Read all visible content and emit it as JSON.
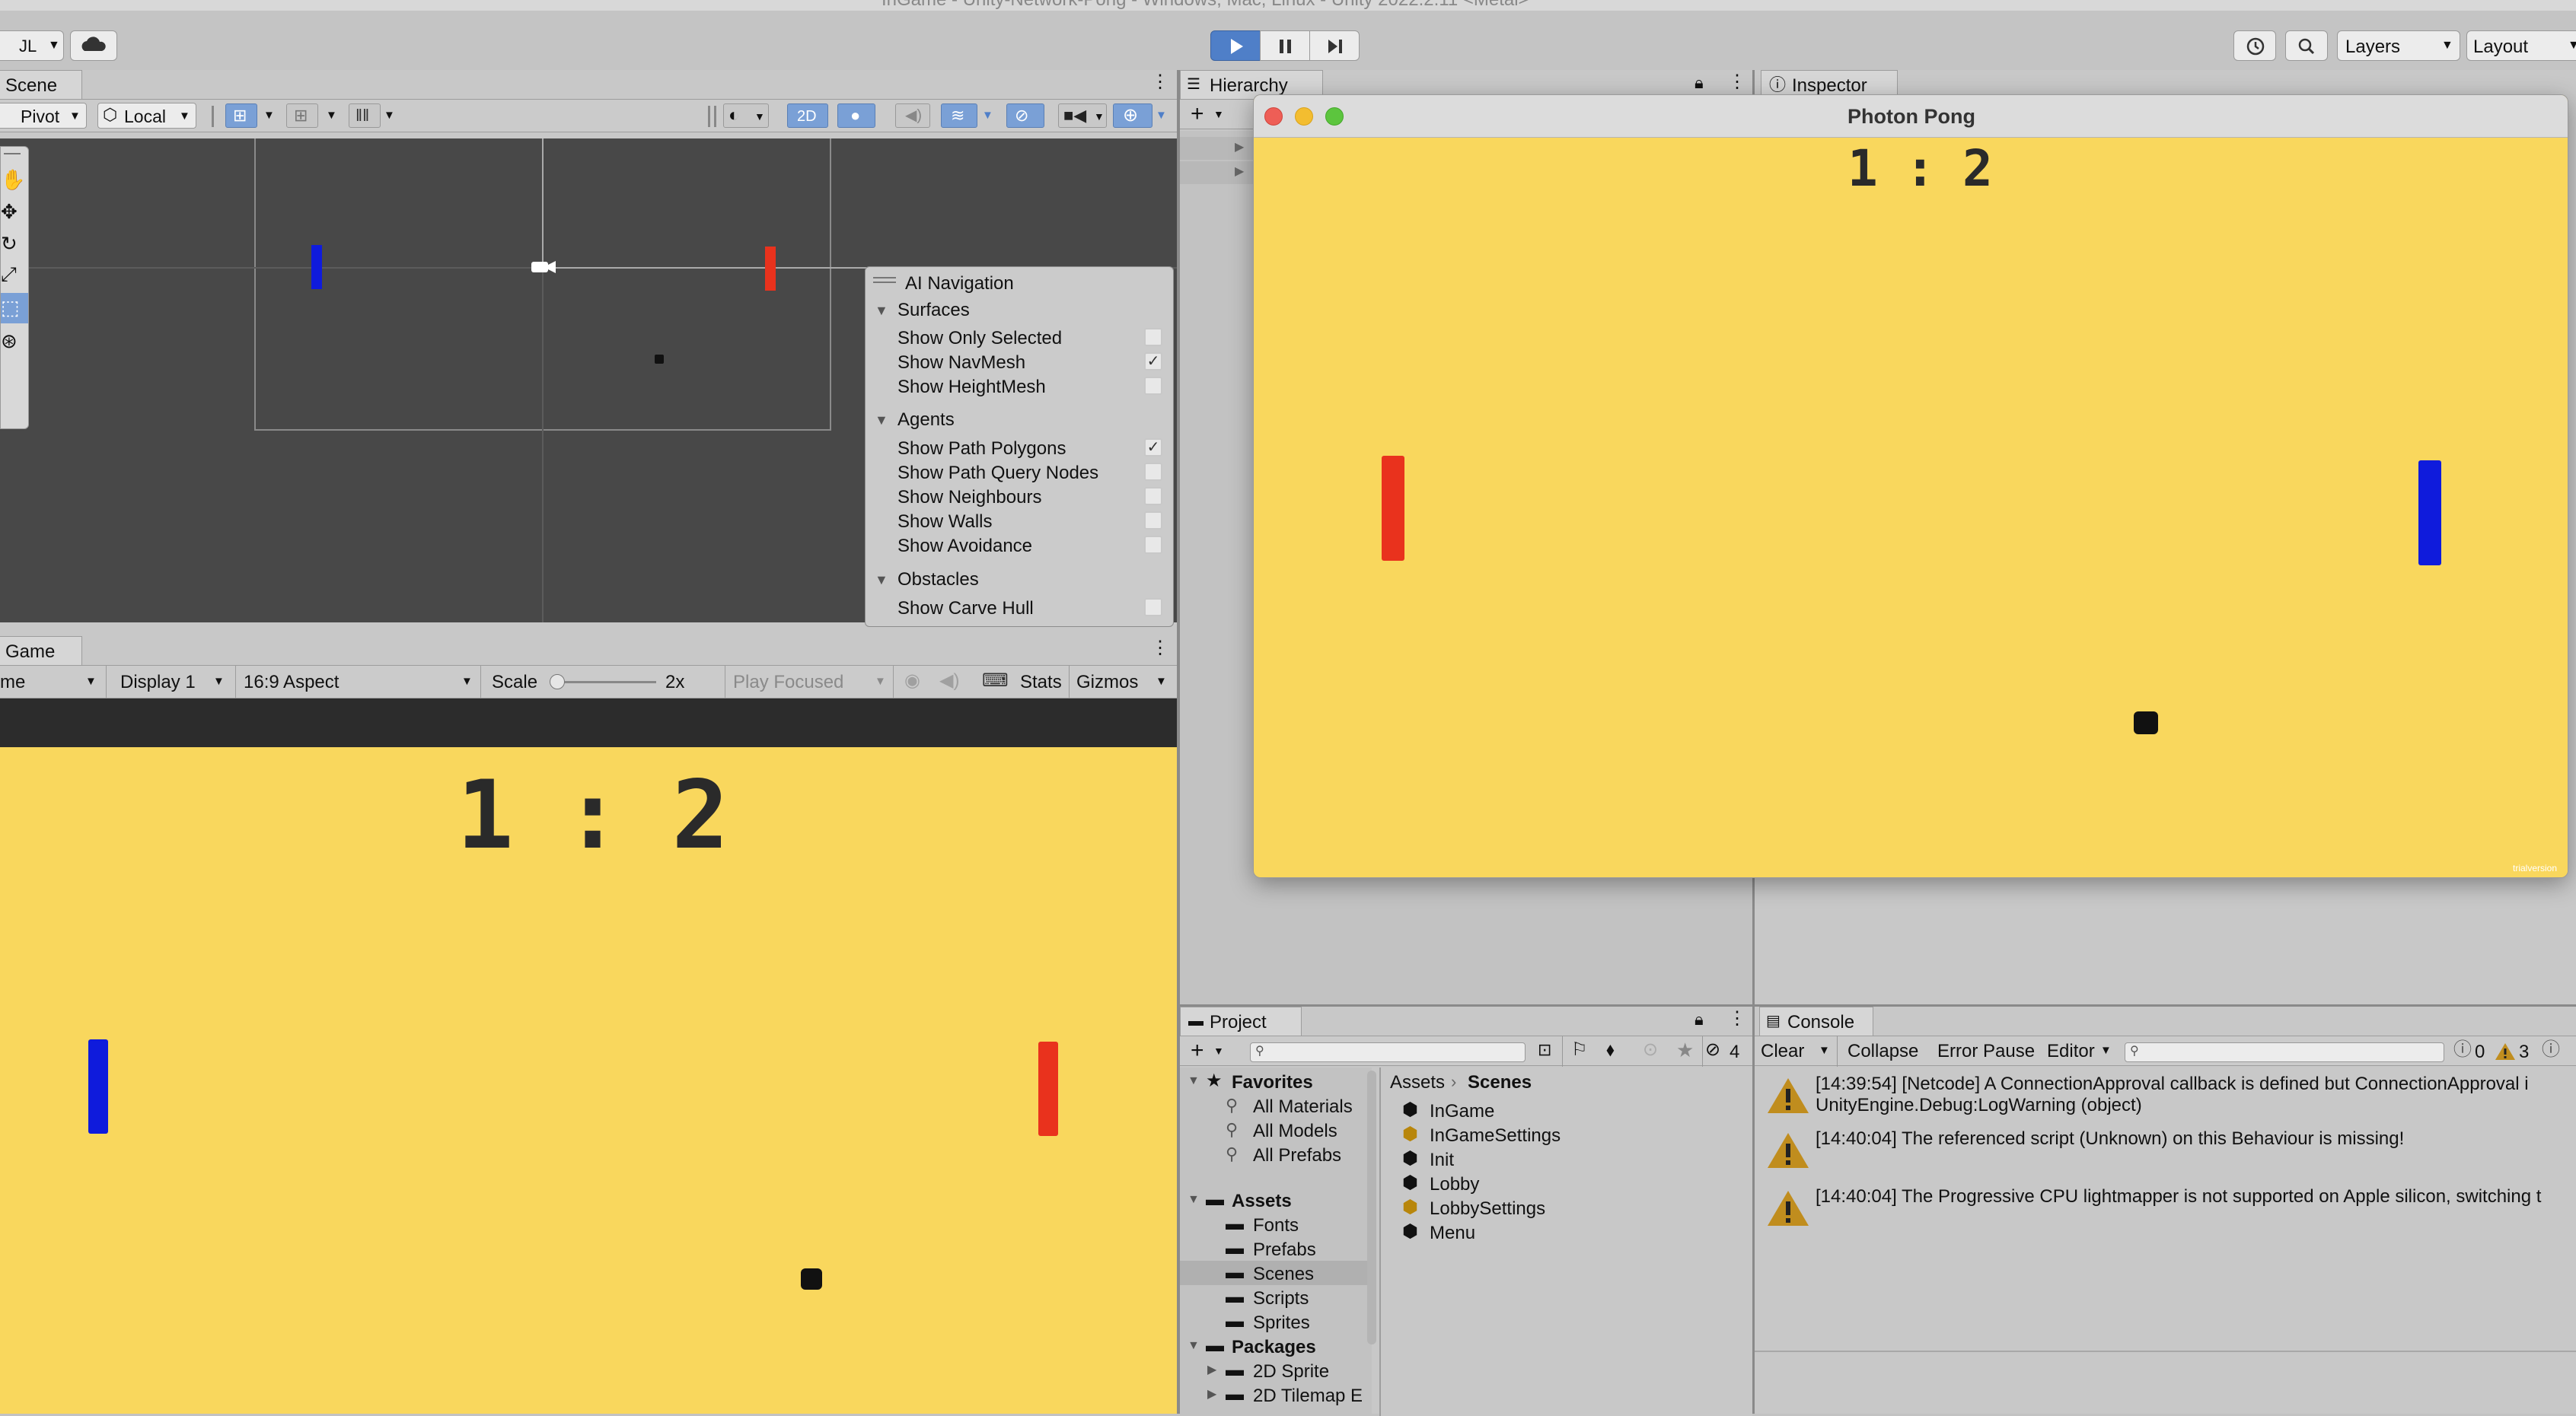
{
  "window_title": "InGame - Unity-Network-Pong - Windows, Mac, Linux - Unity 2022.2.11 <Metal>",
  "toolbar": {
    "account": "JL",
    "layers": "Layers",
    "layout": "Layout"
  },
  "scene": {
    "tab": "Scene",
    "pivot": "Pivot",
    "local": "Local",
    "mode_2d": "2D"
  },
  "ai_nav": {
    "title": "AI Navigation",
    "sections": [
      {
        "name": "Surfaces",
        "items": [
          {
            "label": "Show Only Selected",
            "checked": false
          },
          {
            "label": "Show NavMesh",
            "checked": true
          },
          {
            "label": "Show HeightMesh",
            "checked": false
          }
        ]
      },
      {
        "name": "Agents",
        "items": [
          {
            "label": "Show Path Polygons",
            "checked": true
          },
          {
            "label": "Show Path Query Nodes",
            "checked": false
          },
          {
            "label": "Show Neighbours",
            "checked": false
          },
          {
            "label": "Show Walls",
            "checked": false
          },
          {
            "label": "Show Avoidance",
            "checked": false
          }
        ]
      },
      {
        "name": "Obstacles",
        "items": [
          {
            "label": "Show Carve Hull",
            "checked": false
          }
        ]
      }
    ]
  },
  "game": {
    "tab": "Game",
    "mode": "me",
    "display": "Display 1",
    "aspect": "16:9 Aspect",
    "scale_label": "Scale",
    "scale_value": "2x",
    "play_focused": "Play Focused",
    "stats": "Stats",
    "gizmos": "Gizmos",
    "score": "1 : 2"
  },
  "hierarchy": {
    "tab": "Hierarchy"
  },
  "inspector": {
    "tab": "Inspector"
  },
  "photon": {
    "title": "Photon Pong",
    "score": "1 : 2",
    "corner": "trialversion"
  },
  "project": {
    "tab": "Project",
    "hidden_count": "4",
    "favorites_label": "Favorites",
    "favorites": [
      "All Materials",
      "All Models",
      "All Prefabs"
    ],
    "assets_label": "Assets",
    "assets": [
      "Fonts",
      "Prefabs",
      "Scenes",
      "Scripts",
      "Sprites"
    ],
    "packages_label": "Packages",
    "packages": [
      "2D Sprite",
      "2D Tilemap E"
    ],
    "breadcrumb_root": "Assets",
    "breadcrumb_current": "Scenes",
    "files": [
      {
        "name": "InGame",
        "kind": "scene"
      },
      {
        "name": "InGameSettings",
        "kind": "settings"
      },
      {
        "name": "Init",
        "kind": "scene"
      },
      {
        "name": "Lobby",
        "kind": "scene"
      },
      {
        "name": "LobbySettings",
        "kind": "settings"
      },
      {
        "name": "Menu",
        "kind": "scene"
      }
    ]
  },
  "console": {
    "tab": "Console",
    "clear": "Clear",
    "collapse": "Collapse",
    "error_pause": "Error Pause",
    "editor": "Editor",
    "info_count": "0",
    "warn_count": "3",
    "logs": [
      {
        "line1": "[14:39:54] [Netcode] A ConnectionApproval callback is defined but ConnectionApproval i",
        "line2": "UnityEngine.Debug:LogWarning (object)"
      },
      {
        "line1": "[14:40:04] The referenced script (Unknown) on this Behaviour is missing!",
        "line2": ""
      },
      {
        "line1": "[14:40:04] The Progressive CPU lightmapper is not supported on Apple silicon, switching t",
        "line2": ""
      }
    ]
  },
  "colors": {
    "game_bg": "#f9d75d",
    "paddle_red": "#e9321d",
    "paddle_blue": "#0f1bdc",
    "scene_bg": "#484848",
    "warning": "#c08d1e"
  }
}
